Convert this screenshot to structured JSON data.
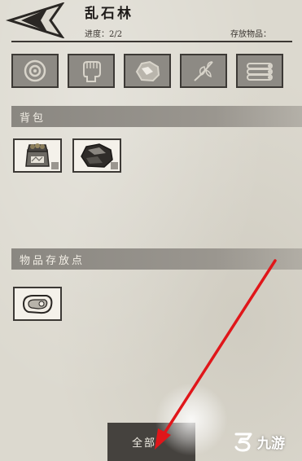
{
  "header": {
    "title": "乱石林",
    "progress_label": "进度：2/2",
    "storage_label": "存放物品："
  },
  "tabs": [
    {
      "icon": "target-icon"
    },
    {
      "icon": "fist-icon"
    },
    {
      "icon": "ore-icon"
    },
    {
      "icon": "herb-icon"
    },
    {
      "icon": "wood-logs-icon"
    }
  ],
  "backpack": {
    "title": "背包",
    "items": [
      {
        "icon": "supply-bag-icon"
      },
      {
        "icon": "ore-chunk-icon"
      }
    ]
  },
  "storage_point": {
    "title": "物品存放点",
    "items": [
      {
        "icon": "raw-meat-icon"
      }
    ]
  },
  "collect_button": {
    "label": "全部"
  },
  "watermark": {
    "text": "九游"
  },
  "colors": {
    "paper": "#dcd9cf",
    "section_bar": "#8a8781",
    "button": "#45423e",
    "annotation_arrow": "#e0161a"
  }
}
